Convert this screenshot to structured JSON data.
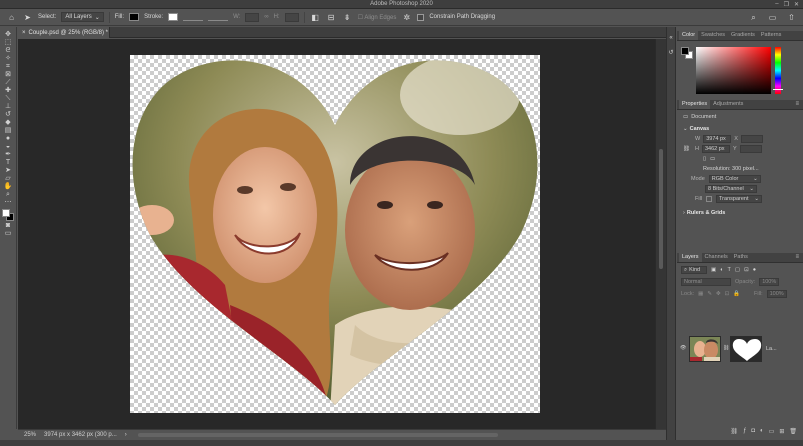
{
  "window": {
    "title": "Adobe Photoshop 2020",
    "controls": [
      "–",
      "❐",
      "✕"
    ]
  },
  "options_bar": {
    "select_label": "Select:",
    "select_value": "All Layers",
    "fill_label": "Fill:",
    "stroke_label": "Stroke:",
    "w_label": "W:",
    "h_label": "H:",
    "align_edges_label": "Align Edges",
    "constrain_label": "Constrain Path Dragging"
  },
  "document_tab": {
    "label": "Couple.psd @ 25% (RGB/8) *"
  },
  "status_bar": {
    "zoom": "25%",
    "info": "3974 px x 3462 px (300 p..."
  },
  "color_panel": {
    "tabs": [
      "Color",
      "Swatches",
      "Gradients",
      "Patterns"
    ]
  },
  "properties_panel": {
    "tabs": [
      "Properties",
      "Adjustments"
    ],
    "document_label": "Document",
    "canvas_section": "Canvas",
    "width_label": "W",
    "width_value": "3974 px",
    "x_label": "X",
    "height_label": "H",
    "height_value": "3462 px",
    "y_label": "Y",
    "resolution": "Resolution: 300 pixel...",
    "mode_label": "Mode",
    "mode_value": "RGB Color",
    "depth_value": "8 Bits/Channel",
    "fill_label": "Fill",
    "fill_value": "Transparent",
    "rulers_section": "Rulers & Grids"
  },
  "layers_panel": {
    "tabs": [
      "Layers",
      "Channels",
      "Paths"
    ],
    "kind_label": "Kind",
    "blend_mode": "Normal",
    "opacity_label": "Opacity:",
    "opacity_value": "100%",
    "lock_label": "Lock:",
    "fill_label": "Fill:",
    "fill_value": "100%",
    "layer_name": "La..."
  },
  "colors": {
    "accent": "#1473e6"
  }
}
